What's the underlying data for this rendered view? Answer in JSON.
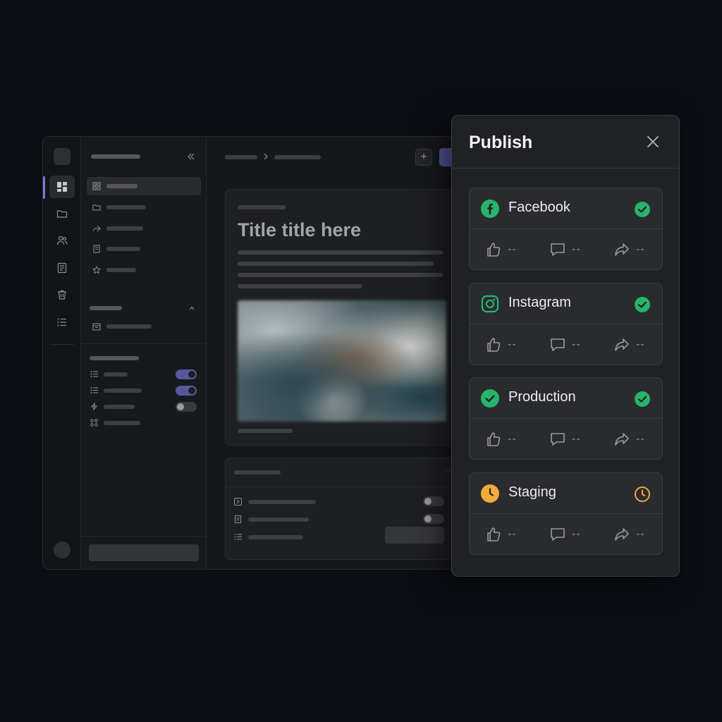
{
  "document": {
    "title": "Title title here"
  },
  "sidebar": {
    "icons": [
      "dashboard-icon",
      "folder-icon",
      "users-icon",
      "document-icon",
      "trash-icon",
      "list-icon"
    ],
    "nav_icons": [
      "grid-icon",
      "folder-icon",
      "share-icon",
      "file-icon",
      "star-icon"
    ],
    "toggles": [
      true,
      true,
      false
    ]
  },
  "content_toggles": [
    false,
    false
  ],
  "publish": {
    "title": "Publish",
    "channels": [
      {
        "name": "Facebook",
        "icon": "facebook-icon",
        "status": "published",
        "likes": "--",
        "comments": "--",
        "shares": "--"
      },
      {
        "name": "Instagram",
        "icon": "instagram-icon",
        "status": "published",
        "likes": "--",
        "comments": "--",
        "shares": "--"
      },
      {
        "name": "Production",
        "icon": "check-circle-icon",
        "status": "published",
        "likes": "--",
        "comments": "--",
        "shares": "--"
      },
      {
        "name": "Staging",
        "icon": "clock-icon",
        "status": "pending",
        "likes": "--",
        "comments": "--",
        "shares": "--"
      }
    ]
  },
  "colors": {
    "success": "#27b46b",
    "pending": "#f1a93a",
    "accent": "#58589e",
    "instagram": "#27b46b"
  }
}
